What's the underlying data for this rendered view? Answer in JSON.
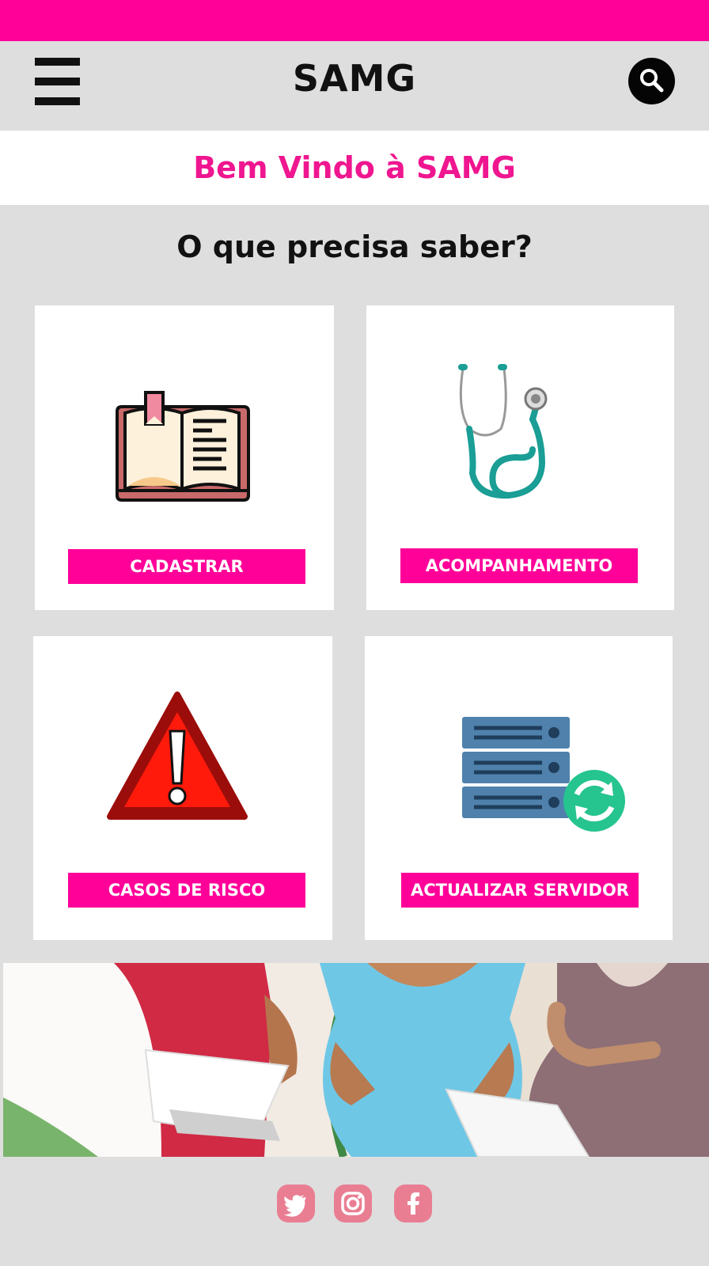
{
  "header": {
    "title": "SAMG"
  },
  "welcome": {
    "text": "Bem Vindo à SAMG"
  },
  "main": {
    "question": "O que precisa saber?",
    "cards": [
      {
        "label": "CADASTRAR",
        "icon": "open-book-icon"
      },
      {
        "label": "ACOMPANHAMENTO",
        "icon": "stethoscope-icon"
      },
      {
        "label": "CASOS DE RISCO",
        "icon": "warning-triangle-icon"
      },
      {
        "label": "ACTUALIZAR SERVIDOR",
        "icon": "server-sync-icon"
      }
    ]
  },
  "banner": {
    "description_icon": "pregnant-women-photo"
  },
  "footer": {
    "social": [
      "twitter-icon",
      "instagram-icon",
      "facebook-icon"
    ]
  },
  "colors": {
    "accent": "#ff0099",
    "title_pink": "#ef1690",
    "background": "#dedede",
    "social": "#e97e93"
  }
}
